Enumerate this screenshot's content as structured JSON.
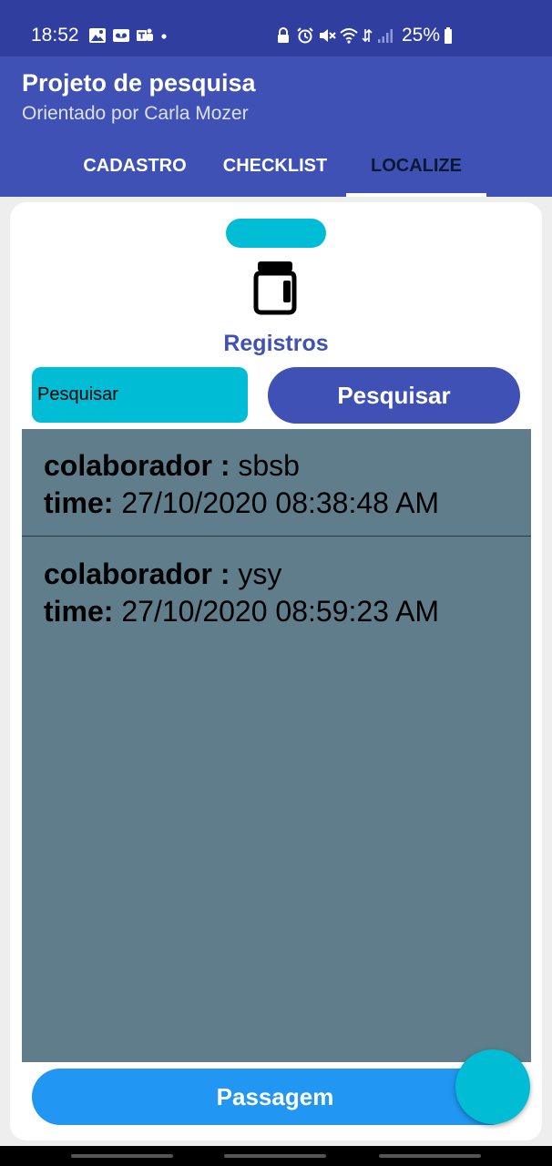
{
  "status_bar": {
    "time": "18:52",
    "battery": "25%",
    "left_icons": [
      "gallery-icon",
      "voicemail-icon",
      "teams-icon",
      "notification-dot-icon"
    ],
    "right_icons": [
      "lock-icon",
      "alarm-icon",
      "mute-icon",
      "wifi-icon",
      "data-icon",
      "signal-icon",
      "battery-icon"
    ]
  },
  "app_bar": {
    "title": "Projeto de pesquisa",
    "subtitle": "Orientado por Carla Mozer",
    "tabs": [
      {
        "label": "CADASTRO",
        "active": false
      },
      {
        "label": "CHECKLIST",
        "active": false
      },
      {
        "label": "LOCALIZE",
        "active": true
      }
    ]
  },
  "card": {
    "icon": "jar-icon",
    "title": "Registros",
    "search": {
      "placeholder": "Pesquisar",
      "button_label": "Pesquisar"
    },
    "records": [
      {
        "colaborador_label": "colaborador :",
        "colaborador": "sbsb",
        "time_label": "time:",
        "time": "27/10/2020 08:38:48 AM"
      },
      {
        "colaborador_label": "colaborador :",
        "colaborador": "ysy",
        "time_label": "time:",
        "time": "27/10/2020 08:59:23 AM"
      }
    ],
    "action_button": "Passagem"
  },
  "colors": {
    "status_bar": "#303f9f",
    "app_bar": "#3f51b5",
    "accent_cyan": "#00bcd4",
    "list_background": "#607d8b",
    "action_blue": "#2196f3"
  }
}
